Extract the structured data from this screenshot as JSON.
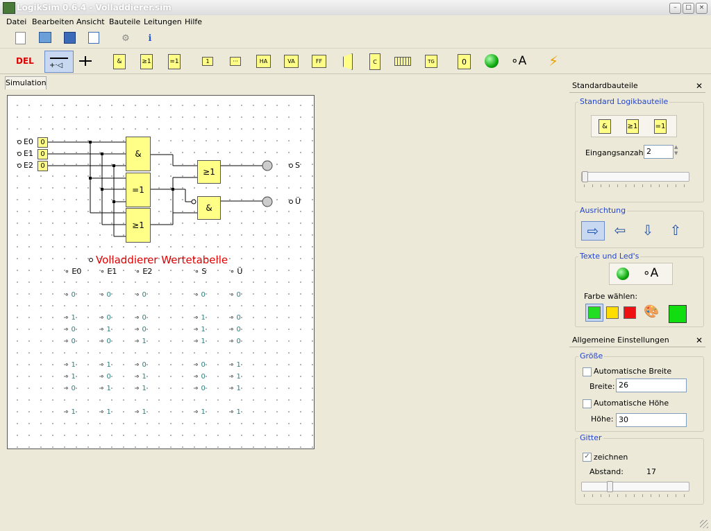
{
  "window": {
    "title": "LogikSim 0.6.4 - Volladdierer.sim"
  },
  "menu": [
    "Datei",
    "Bearbeiten",
    "Ansicht",
    "Bauteile",
    "Leitungen",
    "Hilfe"
  ],
  "toolbar2": {
    "del_label": "DEL",
    "and_label": "&",
    "or_label": "≥1",
    "xor_label": "=1",
    "buffer_label": "1",
    "ha_label": "HA",
    "va_label": "VA",
    "ff_label": "FF",
    "counter_label": "C",
    "tg_label": "TG",
    "zero_label": "0",
    "text_label": "∘A"
  },
  "tab": {
    "label": "Simulation"
  },
  "circuit": {
    "inputs": [
      {
        "name": "E0",
        "value": "0"
      },
      {
        "name": "E1",
        "value": "0"
      },
      {
        "name": "E2",
        "value": "0"
      }
    ],
    "gates": {
      "and1": "&",
      "xor": "=1",
      "or1": "≥1",
      "or_out": "≥1",
      "and_out": "&"
    },
    "outputs": [
      "S",
      "Ü"
    ],
    "table_title": "Volladdierer Wertetabelle",
    "table_headers": [
      "E0",
      "E1",
      "E2",
      "S",
      "Ü"
    ],
    "table_rows": [
      [
        "0",
        "0",
        "0",
        "0",
        "0"
      ],
      [
        "1",
        "0",
        "0",
        "1",
        "0"
      ],
      [
        "0",
        "1",
        "0",
        "1",
        "0"
      ],
      [
        "0",
        "0",
        "1",
        "1",
        "0"
      ],
      [
        "1",
        "1",
        "0",
        "0",
        "1"
      ],
      [
        "1",
        "0",
        "1",
        "0",
        "1"
      ],
      [
        "0",
        "1",
        "1",
        "0",
        "1"
      ],
      [
        "1",
        "1",
        "1",
        "1",
        "1"
      ]
    ]
  },
  "panel_standard": {
    "header": "Standardbauteile",
    "group_title": "Standard Logikbauteile",
    "gate_and": "&",
    "gate_or": "≥1",
    "gate_xor": "=1",
    "input_count_label": "Eingangsanzahl:",
    "input_count_value": "2",
    "orientation_title": "Ausrichtung",
    "texts_title": "Texte und Led's",
    "text_icon": "∘A",
    "color_label": "Farbe wählen:",
    "colors": [
      "#22dd22",
      "#ffdd00",
      "#ee1111"
    ],
    "selected_color": "#11dd11"
  },
  "panel_general": {
    "header": "Allgemeine Einstellungen",
    "size_title": "Größe",
    "auto_width_label": "Automatische Breite",
    "width_label": "Breite:",
    "width_value": "26",
    "auto_height_label": "Automatische Höhe",
    "height_label": "Höhe:",
    "height_value": "30",
    "grid_title": "Gitter",
    "draw_label": "zeichnen",
    "spacing_label": "Abstand:",
    "spacing_value": "17"
  }
}
